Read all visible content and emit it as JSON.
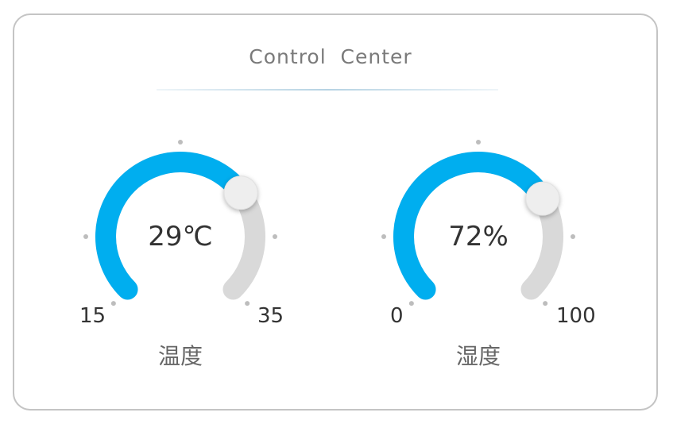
{
  "title": "Control  Center",
  "colors": {
    "accent": "#00aeef",
    "track": "#d9d9d9",
    "knob": "#eeeeee",
    "tick": "#bdbdbd"
  },
  "gauges": [
    {
      "name": "温度",
      "value_text": "29℃",
      "value": 29,
      "min": 15,
      "max": 35,
      "min_label": "15",
      "max_label": "35"
    },
    {
      "name": "湿度",
      "value_text": "72%",
      "value": 72,
      "min": 0,
      "max": 100,
      "min_label": "0",
      "max_label": "100"
    }
  ]
}
